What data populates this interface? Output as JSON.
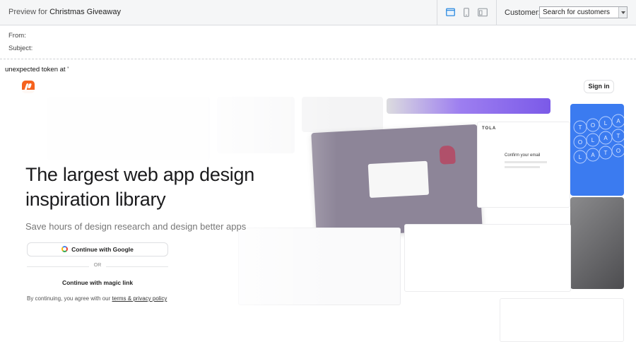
{
  "toolbar": {
    "preview_prefix": "Preview for",
    "campaign_name": "Christmas Giveaway",
    "customer_label": "Customer:",
    "customer_value": "Search for customers",
    "devices": [
      "desktop-icon",
      "mobile-icon",
      "split-view-icon"
    ],
    "active_device_color": "#2f8be0"
  },
  "header": {
    "from_label": "From:",
    "subject_label": "Subject:"
  },
  "error_text": "unexpected token at '",
  "email": {
    "brand_color": "#f5621e",
    "signin_label": "Sign in",
    "hero_title": "The largest web app design inspiration library",
    "subtitle": "Save hours of design research and design better apps",
    "google_button": "Continue with Google",
    "or_text": "OR",
    "magic_link": "Continue with magic link",
    "terms_prefix": "By continuing, you agree with our",
    "terms_link": "terms & privacy policy",
    "collage": {
      "tola_logo": "TOLA",
      "confirm_heading": "Confirm your email",
      "letters": [
        "T",
        "O",
        "L",
        "A",
        "O",
        "L",
        "A",
        "T",
        "L",
        "A",
        "T",
        "O"
      ]
    }
  }
}
